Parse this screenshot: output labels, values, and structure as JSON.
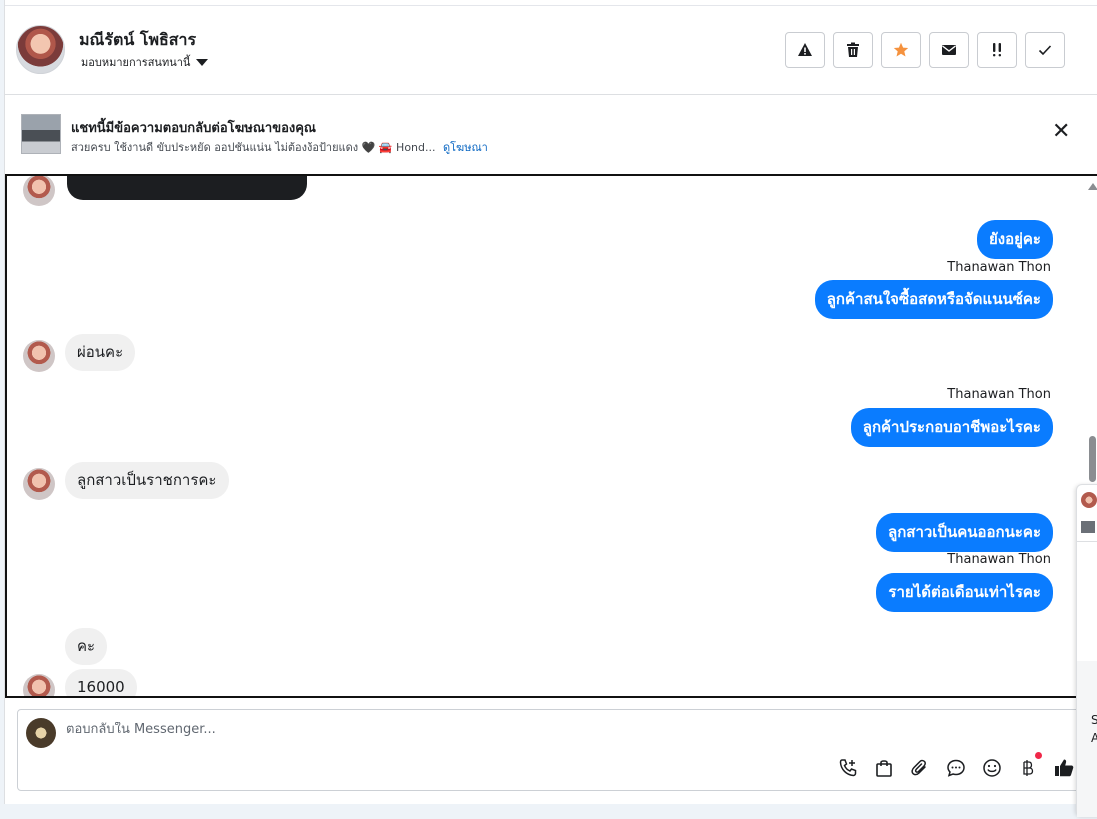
{
  "header": {
    "contact_name": "มณีรัตน์ โพธิสาร",
    "assign_label": "มอบหมายการสนทนานี้",
    "actions": [
      {
        "name": "report-spam-button",
        "icon": "warning-icon"
      },
      {
        "name": "delete-button",
        "icon": "trash-icon"
      },
      {
        "name": "star-button",
        "icon": "star-icon"
      },
      {
        "name": "mark-unread-button",
        "icon": "envelope-icon"
      },
      {
        "name": "follow-up-button",
        "icon": "exclamation-icon"
      },
      {
        "name": "mark-done-button",
        "icon": "check-icon"
      }
    ]
  },
  "ad_banner": {
    "title": "แชทนี้มีข้อความตอบกลับต่อโฆษณาของคุณ",
    "description": "สวยครบ ใช้งานดี ขับประหยัด ออปชันแน่น ไม่ต้องง้อป้ายแดง 🖤 🚘 Hond...",
    "link": "ดูโฆษณา"
  },
  "messages": [
    {
      "dir": "out",
      "text": "ยังอยู่คะ"
    },
    {
      "dir": "sender",
      "text": "Thanawan Thon"
    },
    {
      "dir": "out",
      "text": "ลูกค้าสนใจซื้อสดหรือจัดแนนซ์คะ"
    },
    {
      "dir": "in",
      "text": "ผ่อนคะ"
    },
    {
      "dir": "sender",
      "text": "Thanawan Thon"
    },
    {
      "dir": "out",
      "text": "ลูกค้าประกอบอาชีพอะไรคะ"
    },
    {
      "dir": "in",
      "text": "ลูกสาวเป็นราชการคะ"
    },
    {
      "dir": "out",
      "text": "ลูกสาวเป็นคนออกนะคะ"
    },
    {
      "dir": "sender",
      "text": "Thanawan Thon"
    },
    {
      "dir": "out",
      "text": "รายได้ต่อเดือนเท่าไรคะ"
    },
    {
      "dir": "in",
      "text": "คะ"
    },
    {
      "dir": "in",
      "text": "16000"
    }
  ],
  "composer": {
    "placeholder": "ตอบกลับใน Messenger...",
    "tools": [
      "call-icon",
      "shopping-bag-icon",
      "paperclip-icon",
      "saved-reply-icon",
      "emoji-icon",
      "baht-icon",
      "thumbs-up-icon"
    ]
  },
  "side_panel": {
    "text_1": "S",
    "text_2": "A"
  },
  "colors": {
    "outgoing_bubble": "#0a7cff",
    "incoming_bubble": "#f0f0f0",
    "star": "#f5923e",
    "notification_dot": "#f02849"
  }
}
